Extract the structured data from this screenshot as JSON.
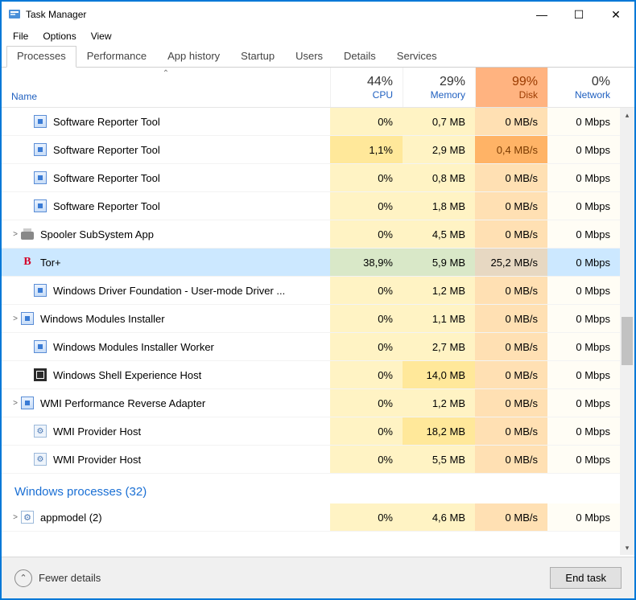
{
  "window": {
    "title": "Task Manager"
  },
  "menu": {
    "file": "File",
    "options": "Options",
    "view": "View"
  },
  "tabs": {
    "processes": "Processes",
    "performance": "Performance",
    "app_history": "App history",
    "startup": "Startup",
    "users": "Users",
    "details": "Details",
    "services": "Services"
  },
  "columns": {
    "name": "Name",
    "cpu": {
      "pct": "44%",
      "label": "CPU"
    },
    "memory": {
      "pct": "29%",
      "label": "Memory"
    },
    "disk": {
      "pct": "99%",
      "label": "Disk"
    },
    "network": {
      "pct": "0%",
      "label": "Network"
    }
  },
  "rows": [
    {
      "icon": "default",
      "name": "Software Reporter Tool",
      "cpu": "0%",
      "mem": "0,7 MB",
      "disk": "0 MB/s",
      "net": "0 Mbps",
      "expand": false,
      "indent": true
    },
    {
      "icon": "default",
      "name": "Software Reporter Tool",
      "cpu": "1,1%",
      "mem": "2,9 MB",
      "disk": "0,4 MB/s",
      "net": "0 Mbps",
      "cpu_med": true,
      "disk_med": true,
      "expand": false,
      "indent": true
    },
    {
      "icon": "default",
      "name": "Software Reporter Tool",
      "cpu": "0%",
      "mem": "0,8 MB",
      "disk": "0 MB/s",
      "net": "0 Mbps",
      "expand": false,
      "indent": true
    },
    {
      "icon": "default",
      "name": "Software Reporter Tool",
      "cpu": "0%",
      "mem": "1,8 MB",
      "disk": "0 MB/s",
      "net": "0 Mbps",
      "expand": false,
      "indent": true
    },
    {
      "icon": "printer",
      "name": "Spooler SubSystem App",
      "cpu": "0%",
      "mem": "4,5 MB",
      "disk": "0 MB/s",
      "net": "0 Mbps",
      "expand": true
    },
    {
      "icon": "tor",
      "name": "Tor+",
      "cpu": "38,9%",
      "mem": "5,9 MB",
      "disk": "25,2 MB/s",
      "net": "0 Mbps",
      "selected": true
    },
    {
      "icon": "default",
      "name": "Windows Driver Foundation - User-mode Driver ...",
      "cpu": "0%",
      "mem": "1,2 MB",
      "disk": "0 MB/s",
      "net": "0 Mbps",
      "indent": true
    },
    {
      "icon": "default",
      "name": "Windows Modules Installer",
      "cpu": "0%",
      "mem": "1,1 MB",
      "disk": "0 MB/s",
      "net": "0 Mbps",
      "expand": true
    },
    {
      "icon": "default",
      "name": "Windows Modules Installer Worker",
      "cpu": "0%",
      "mem": "2,7 MB",
      "disk": "0 MB/s",
      "net": "0 Mbps",
      "indent": true
    },
    {
      "icon": "shell",
      "name": "Windows Shell Experience Host",
      "cpu": "0%",
      "mem": "14,0 MB",
      "disk": "0 MB/s",
      "net": "0 Mbps",
      "indent": true,
      "mem_med": true
    },
    {
      "icon": "default",
      "name": "WMI Performance Reverse Adapter",
      "cpu": "0%",
      "mem": "1,2 MB",
      "disk": "0 MB/s",
      "net": "0 Mbps",
      "expand": true
    },
    {
      "icon": "svc",
      "name": "WMI Provider Host",
      "cpu": "0%",
      "mem": "18,2 MB",
      "disk": "0 MB/s",
      "net": "0 Mbps",
      "indent": true,
      "mem_med": true
    },
    {
      "icon": "svc",
      "name": "WMI Provider Host",
      "cpu": "0%",
      "mem": "5,5 MB",
      "disk": "0 MB/s",
      "net": "0 Mbps",
      "indent": true
    }
  ],
  "group": {
    "label": "Windows processes (32)"
  },
  "group_row": {
    "icon": "gear",
    "name": "appmodel (2)",
    "cpu": "0%",
    "mem": "4,6 MB",
    "disk": "0 MB/s",
    "net": "0 Mbps",
    "expand": true
  },
  "footer": {
    "fewer": "Fewer details",
    "end_task": "End task"
  }
}
